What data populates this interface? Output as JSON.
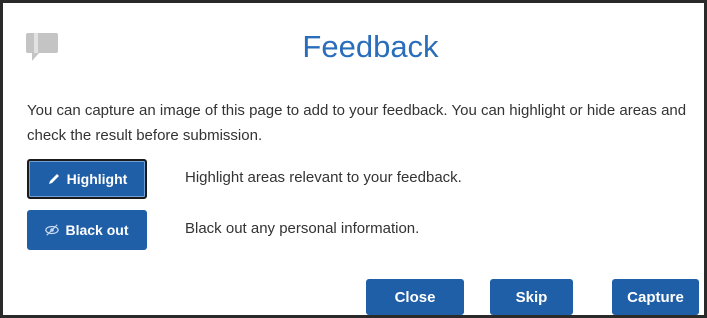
{
  "dialog": {
    "title": "Feedback",
    "logo_icon": "speech-bubble-icon",
    "intro_text": "You can capture an image of this page to add to your feedback. You can highlight or hide areas and check the result before submission.",
    "options": {
      "highlight": {
        "label": "Highlight",
        "icon": "pen-icon",
        "description": "Highlight areas relevant to your feedback."
      },
      "blackout": {
        "label": "Black out",
        "icon": "eye-slash-icon",
        "description": "Black out any personal information."
      }
    },
    "buttons": {
      "close": "Close",
      "skip": "Skip",
      "capture": "Capture"
    }
  },
  "colors": {
    "title": "#2a6ebb",
    "button": "#1f5fa8",
    "text": "#333333",
    "logo": "#bfbfbf"
  }
}
